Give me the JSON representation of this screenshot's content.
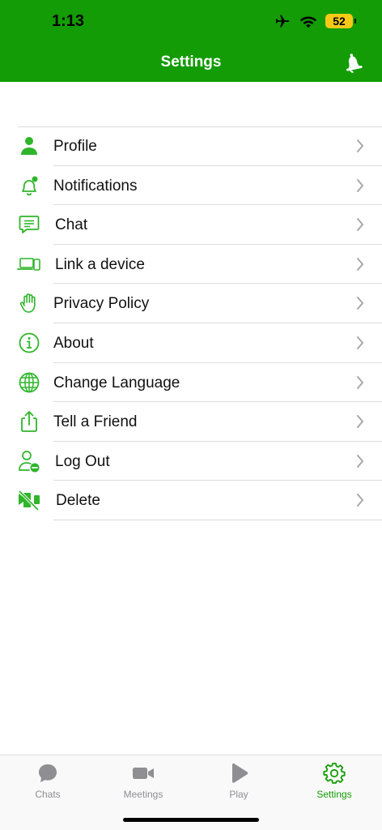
{
  "status_bar": {
    "time": "1:13",
    "battery": "52"
  },
  "header": {
    "title": "Settings",
    "bell_icon": "bell-icon"
  },
  "menu": {
    "items": [
      {
        "label": "Profile",
        "icon": "person-icon"
      },
      {
        "label": "Notifications",
        "icon": "bell-badge-icon"
      },
      {
        "label": "Chat",
        "icon": "chat-bubble-icon"
      },
      {
        "label": "Link a device",
        "icon": "devices-icon"
      },
      {
        "label": "Privacy Policy",
        "icon": "hand-icon"
      },
      {
        "label": "About",
        "icon": "info-icon"
      },
      {
        "label": "Change Language",
        "icon": "globe-icon"
      },
      {
        "label": "Tell a Friend",
        "icon": "share-icon"
      },
      {
        "label": "Log Out",
        "icon": "person-minus-icon"
      },
      {
        "label": "Delete",
        "icon": "delete-account-icon"
      }
    ]
  },
  "tabbar": {
    "tabs": [
      {
        "label": "Chats",
        "icon": "chat-icon",
        "active": false
      },
      {
        "label": "Meetings",
        "icon": "video-icon",
        "active": false
      },
      {
        "label": "Play",
        "icon": "play-icon",
        "active": false
      },
      {
        "label": "Settings",
        "icon": "gear-icon",
        "active": true
      }
    ]
  },
  "colors": {
    "accent": "#139c05",
    "icon_green": "#2fb52a",
    "inactive": "#8e8e93"
  }
}
